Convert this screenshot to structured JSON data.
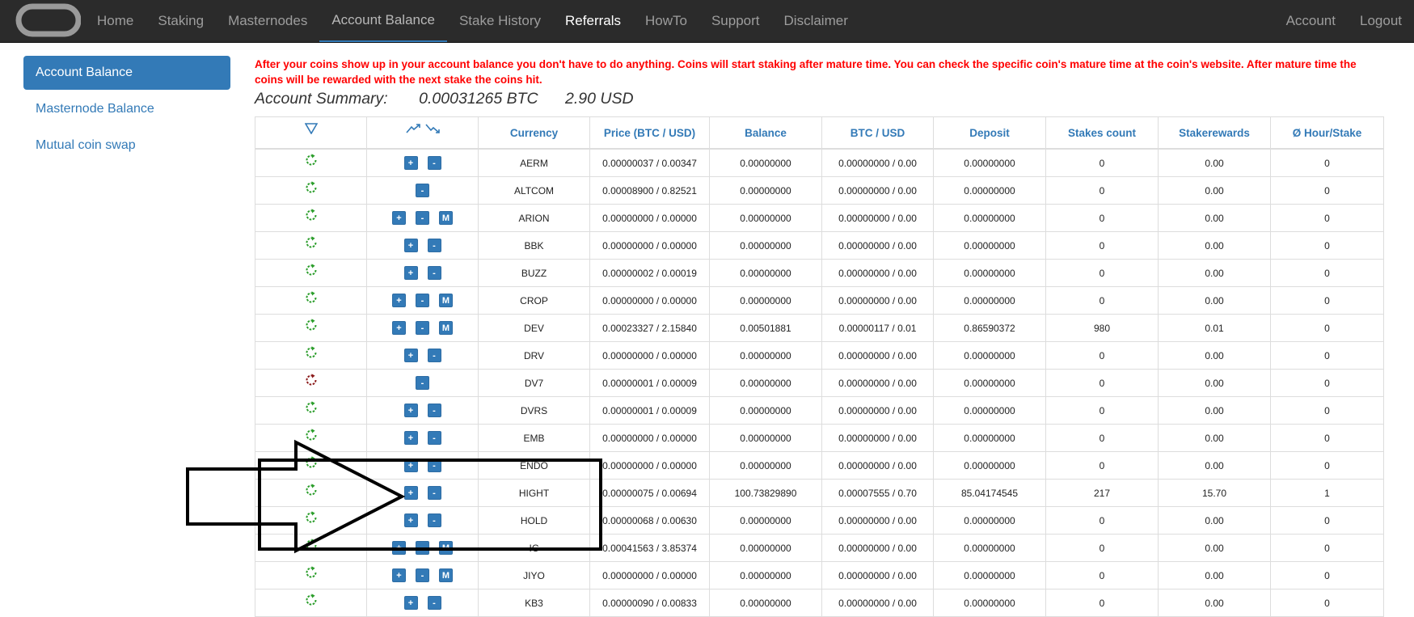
{
  "nav": {
    "left_items": [
      {
        "label": "Home",
        "state": "normal"
      },
      {
        "label": "Staking",
        "state": "normal"
      },
      {
        "label": "Masternodes",
        "state": "normal"
      },
      {
        "label": "Account Balance",
        "state": "active"
      },
      {
        "label": "Stake History",
        "state": "normal"
      },
      {
        "label": "Referrals",
        "state": "highlight"
      },
      {
        "label": "HowTo",
        "state": "normal"
      },
      {
        "label": "Support",
        "state": "normal"
      },
      {
        "label": "Disclaimer",
        "state": "normal"
      }
    ],
    "right_items": [
      {
        "label": "Account"
      },
      {
        "label": "Logout"
      }
    ]
  },
  "sidebar": {
    "items": [
      {
        "label": "Account Balance",
        "active": true
      },
      {
        "label": "Masternode Balance",
        "active": false
      },
      {
        "label": "Mutual coin swap",
        "active": false
      }
    ]
  },
  "notice": "After your coins show up in your account balance you don't have to do anything. Coins will start staking after mature time. You can check the specific coin's mature time at the coin's website. After mature time the coins will be rewarded with the next stake the coins hit.",
  "summary": {
    "label": "Account Summary:",
    "btc": "0.00031265 BTC",
    "usd": "2.90 USD"
  },
  "table": {
    "headers": [
      "Currency",
      "Price (BTC / USD)",
      "Balance",
      "BTC / USD",
      "Deposit",
      "Stakes count",
      "Stakerewards",
      "Ø Hour/Stake"
    ],
    "header_icons": [
      "filter-triangle-icon",
      "trend-up-down-icon"
    ],
    "rows": [
      {
        "status": "green",
        "buttons": [
          "+",
          "-"
        ],
        "currency": "AERM",
        "price": "0.00000037 / 0.00347",
        "balance": "0.00000000",
        "btcusd": "0.00000000 / 0.00",
        "deposit": "0.00000000",
        "stakes": "0",
        "rewards": "0.00",
        "hour": "0"
      },
      {
        "status": "green",
        "buttons": [
          "-"
        ],
        "currency": "ALTCOM",
        "price": "0.00008900 / 0.82521",
        "balance": "0.00000000",
        "btcusd": "0.00000000 / 0.00",
        "deposit": "0.00000000",
        "stakes": "0",
        "rewards": "0.00",
        "hour": "0"
      },
      {
        "status": "green",
        "buttons": [
          "+",
          "-",
          "M"
        ],
        "currency": "ARION",
        "price": "0.00000000 / 0.00000",
        "balance": "0.00000000",
        "btcusd": "0.00000000 / 0.00",
        "deposit": "0.00000000",
        "stakes": "0",
        "rewards": "0.00",
        "hour": "0"
      },
      {
        "status": "green",
        "buttons": [
          "+",
          "-"
        ],
        "currency": "BBK",
        "price": "0.00000000 / 0.00000",
        "balance": "0.00000000",
        "btcusd": "0.00000000 / 0.00",
        "deposit": "0.00000000",
        "stakes": "0",
        "rewards": "0.00",
        "hour": "0"
      },
      {
        "status": "green",
        "buttons": [
          "+",
          "-"
        ],
        "currency": "BUZZ",
        "price": "0.00000002 / 0.00019",
        "balance": "0.00000000",
        "btcusd": "0.00000000 / 0.00",
        "deposit": "0.00000000",
        "stakes": "0",
        "rewards": "0.00",
        "hour": "0"
      },
      {
        "status": "green",
        "buttons": [
          "+",
          "-",
          "M"
        ],
        "currency": "CROP",
        "price": "0.00000000 / 0.00000",
        "balance": "0.00000000",
        "btcusd": "0.00000000 / 0.00",
        "deposit": "0.00000000",
        "stakes": "0",
        "rewards": "0.00",
        "hour": "0"
      },
      {
        "status": "green",
        "buttons": [
          "+",
          "-",
          "M"
        ],
        "currency": "DEV",
        "price": "0.00023327 / 2.15840",
        "balance": "0.00501881",
        "btcusd": "0.00000117 / 0.01",
        "deposit": "0.86590372",
        "stakes": "980",
        "rewards": "0.01",
        "hour": "0"
      },
      {
        "status": "green",
        "buttons": [
          "+",
          "-"
        ],
        "currency": "DRV",
        "price": "0.00000000 / 0.00000",
        "balance": "0.00000000",
        "btcusd": "0.00000000 / 0.00",
        "deposit": "0.00000000",
        "stakes": "0",
        "rewards": "0.00",
        "hour": "0"
      },
      {
        "status": "red",
        "buttons": [
          "-"
        ],
        "currency": "DV7",
        "price": "0.00000001 / 0.00009",
        "balance": "0.00000000",
        "btcusd": "0.00000000 / 0.00",
        "deposit": "0.00000000",
        "stakes": "0",
        "rewards": "0.00",
        "hour": "0"
      },
      {
        "status": "green",
        "buttons": [
          "+",
          "-"
        ],
        "currency": "DVRS",
        "price": "0.00000001 / 0.00009",
        "balance": "0.00000000",
        "btcusd": "0.00000000 / 0.00",
        "deposit": "0.00000000",
        "stakes": "0",
        "rewards": "0.00",
        "hour": "0"
      },
      {
        "status": "green",
        "buttons": [
          "+",
          "-"
        ],
        "currency": "EMB",
        "price": "0.00000000 / 0.00000",
        "balance": "0.00000000",
        "btcusd": "0.00000000 / 0.00",
        "deposit": "0.00000000",
        "stakes": "0",
        "rewards": "0.00",
        "hour": "0"
      },
      {
        "status": "green",
        "buttons": [
          "+",
          "-"
        ],
        "currency": "ENDO",
        "price": "0.00000000 / 0.00000",
        "balance": "0.00000000",
        "btcusd": "0.00000000 / 0.00",
        "deposit": "0.00000000",
        "stakes": "0",
        "rewards": "0.00",
        "hour": "0"
      },
      {
        "status": "green",
        "buttons": [
          "+",
          "-"
        ],
        "currency": "HIGHT",
        "price": "0.00000075 / 0.00694",
        "balance": "100.73829890",
        "btcusd": "0.00007555 / 0.70",
        "deposit": "85.04174545",
        "stakes": "217",
        "rewards": "15.70",
        "hour": "1"
      },
      {
        "status": "green",
        "buttons": [
          "+",
          "-"
        ],
        "currency": "HOLD",
        "price": "0.00000068 / 0.00630",
        "balance": "0.00000000",
        "btcusd": "0.00000000 / 0.00",
        "deposit": "0.00000000",
        "stakes": "0",
        "rewards": "0.00",
        "hour": "0"
      },
      {
        "status": "green",
        "buttons": [
          "+",
          "-",
          "M"
        ],
        "currency": "IC",
        "price": "0.00041563 / 3.85374",
        "balance": "0.00000000",
        "btcusd": "0.00000000 / 0.00",
        "deposit": "0.00000000",
        "stakes": "0",
        "rewards": "0.00",
        "hour": "0"
      },
      {
        "status": "green",
        "buttons": [
          "+",
          "-",
          "M"
        ],
        "currency": "JIYO",
        "price": "0.00000000 / 0.00000",
        "balance": "0.00000000",
        "btcusd": "0.00000000 / 0.00",
        "deposit": "0.00000000",
        "stakes": "0",
        "rewards": "0.00",
        "hour": "0"
      },
      {
        "status": "green",
        "buttons": [
          "+",
          "-"
        ],
        "currency": "KB3",
        "price": "0.00000090 / 0.00833",
        "balance": "0.00000000",
        "btcusd": "0.00000000 / 0.00",
        "deposit": "0.00000000",
        "stakes": "0",
        "rewards": "0.00",
        "hour": "0"
      }
    ]
  },
  "colors": {
    "navbar_bg": "#2b2b2b",
    "accent": "#337ab7",
    "notice": "#ff0000",
    "status_green": "#2a9d2a",
    "status_red": "#8b1a1a"
  },
  "annotation": {
    "shape": "arrow-outline",
    "color": "#000000",
    "points_to_row": "HIGHT"
  }
}
